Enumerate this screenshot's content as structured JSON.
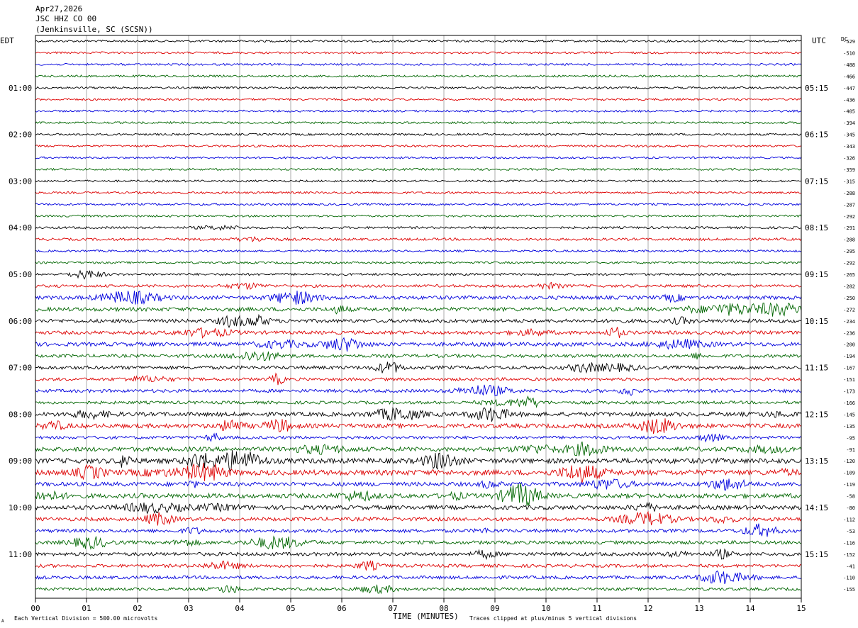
{
  "header": {
    "date": "Apr27,2026",
    "station": "JSC HHZ CO 00",
    "location": "(Jenkinsville, SC (SCSN))"
  },
  "chart_data": {
    "type": "line",
    "left_timezone": "EDT",
    "right_timezone": "UTC",
    "dc_label": "DC",
    "xlabel": "TIME (MINUTES)",
    "x_ticks": [
      "00",
      "01",
      "02",
      "03",
      "04",
      "05",
      "06",
      "07",
      "08",
      "09",
      "10",
      "11",
      "12",
      "13",
      "14",
      "15"
    ],
    "xlim": [
      0,
      15
    ],
    "trace_count": 48,
    "trace_colors": [
      "#000000",
      "#dd0000",
      "#0000dd",
      "#006600"
    ],
    "left_hour_labels": [
      {
        "trace": 4,
        "label": "01:00"
      },
      {
        "trace": 8,
        "label": "02:00"
      },
      {
        "trace": 12,
        "label": "03:00"
      },
      {
        "trace": 16,
        "label": "04:00"
      },
      {
        "trace": 20,
        "label": "05:00"
      },
      {
        "trace": 24,
        "label": "06:00"
      },
      {
        "trace": 28,
        "label": "07:00"
      },
      {
        "trace": 32,
        "label": "08:00"
      },
      {
        "trace": 36,
        "label": "09:00"
      },
      {
        "trace": 40,
        "label": "10:00"
      },
      {
        "trace": 44,
        "label": "11:00"
      }
    ],
    "right_hour_labels": [
      {
        "trace": 4,
        "label": "05:15"
      },
      {
        "trace": 8,
        "label": "06:15"
      },
      {
        "trace": 12,
        "label": "07:15"
      },
      {
        "trace": 16,
        "label": "08:15"
      },
      {
        "trace": 20,
        "label": "09:15"
      },
      {
        "trace": 24,
        "label": "10:15"
      },
      {
        "trace": 28,
        "label": "11:15"
      },
      {
        "trace": 32,
        "label": "12:15"
      },
      {
        "trace": 36,
        "label": "13:15"
      },
      {
        "trace": 40,
        "label": "14:15"
      },
      {
        "trace": 44,
        "label": "15:15"
      }
    ],
    "dc_offsets": [
      "-529",
      "-510",
      "-488",
      "-466",
      "-447",
      "-436",
      "-405",
      "-394",
      "-345",
      "-343",
      "-326",
      "-359",
      "-315",
      "-288",
      "-287",
      "-292",
      "-291",
      "-288",
      "-295",
      "-292",
      "-265",
      "-282",
      "-250",
      "-272",
      "-234",
      "-236",
      "-200",
      "-194",
      "-167",
      "-151",
      "-173",
      "-166",
      "-145",
      "-135",
      "-95",
      "-91",
      "-120",
      "-109",
      "-119",
      "-58",
      "-80",
      "-112",
      "-53",
      "-116",
      "-152",
      "-41",
      "-110",
      "-155"
    ],
    "activity": [
      0.9,
      0.9,
      0.9,
      0.9,
      0.9,
      0.9,
      0.9,
      0.9,
      0.9,
      0.9,
      0.9,
      0.9,
      0.9,
      0.9,
      0.9,
      0.9,
      1.0,
      1.1,
      0.9,
      0.9,
      1.0,
      1.2,
      1.6,
      1.7,
      1.6,
      1.5,
      1.7,
      1.4,
      1.5,
      1.3,
      1.4,
      1.3,
      1.8,
      1.9,
      1.3,
      1.9,
      2.2,
      2.3,
      1.8,
      2.0,
      1.8,
      1.6,
      1.5,
      1.5,
      1.5,
      1.4,
      1.4,
      1.3
    ]
  },
  "footer": {
    "scale_note": "Each Vertical Division =  500.00 microvolts",
    "clip_note": "Traces clipped at plus/minus 5 vertical divisions",
    "corner_mark": "A"
  }
}
